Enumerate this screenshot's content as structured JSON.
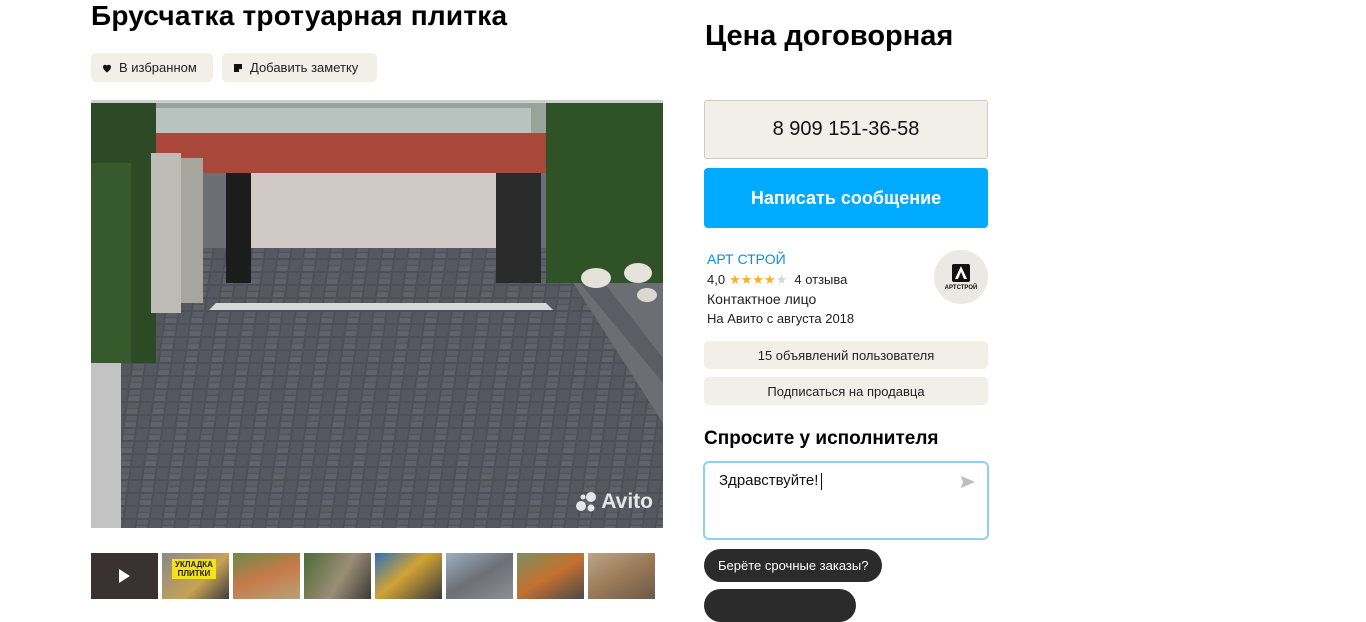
{
  "listing": {
    "title": "Брусчатка тротуарная плитка",
    "favorite_label": "В избранном",
    "add_note_label": "Добавить заметку"
  },
  "gallery": {
    "watermark": "Avito",
    "thumbnails": [
      {
        "type": "video",
        "caption": ""
      },
      {
        "type": "image",
        "caption": "УКЛАДКА ПЛИТКИ"
      },
      {
        "type": "image",
        "caption": ""
      },
      {
        "type": "image",
        "caption": ""
      },
      {
        "type": "image",
        "caption": ""
      },
      {
        "type": "image",
        "caption": ""
      },
      {
        "type": "image",
        "caption": ""
      },
      {
        "type": "image",
        "caption": ""
      }
    ]
  },
  "sidebar": {
    "price": "Цена договорная",
    "phone": "8 909 151-36-58",
    "message_button": "Написать сообщение",
    "seller": {
      "name": "АРТ СТРОЙ",
      "rating": "4,0",
      "stars_filled": 4,
      "stars_total": 5,
      "reviews": "4 отзыва",
      "contact": "Контактное лицо",
      "since": "На Авито с августа 2018",
      "avatar_text": "АРТСТРОЙ"
    },
    "ads_button": "15 объявлений пользователя",
    "subscribe_button": "Подписаться на продавца",
    "ask_heading": "Спросите у исполнителя",
    "ask_text": "Здравствуйте!",
    "quick_reply": "Берёте срочные заказы?"
  },
  "colors": {
    "accent": "#00aaff",
    "seller_link": "#0a8ee6",
    "star": "#ffb021",
    "star_empty": "#d6d6d6",
    "pill_bg": "#f2efe9",
    "chip_bg": "#2b2b2b"
  }
}
